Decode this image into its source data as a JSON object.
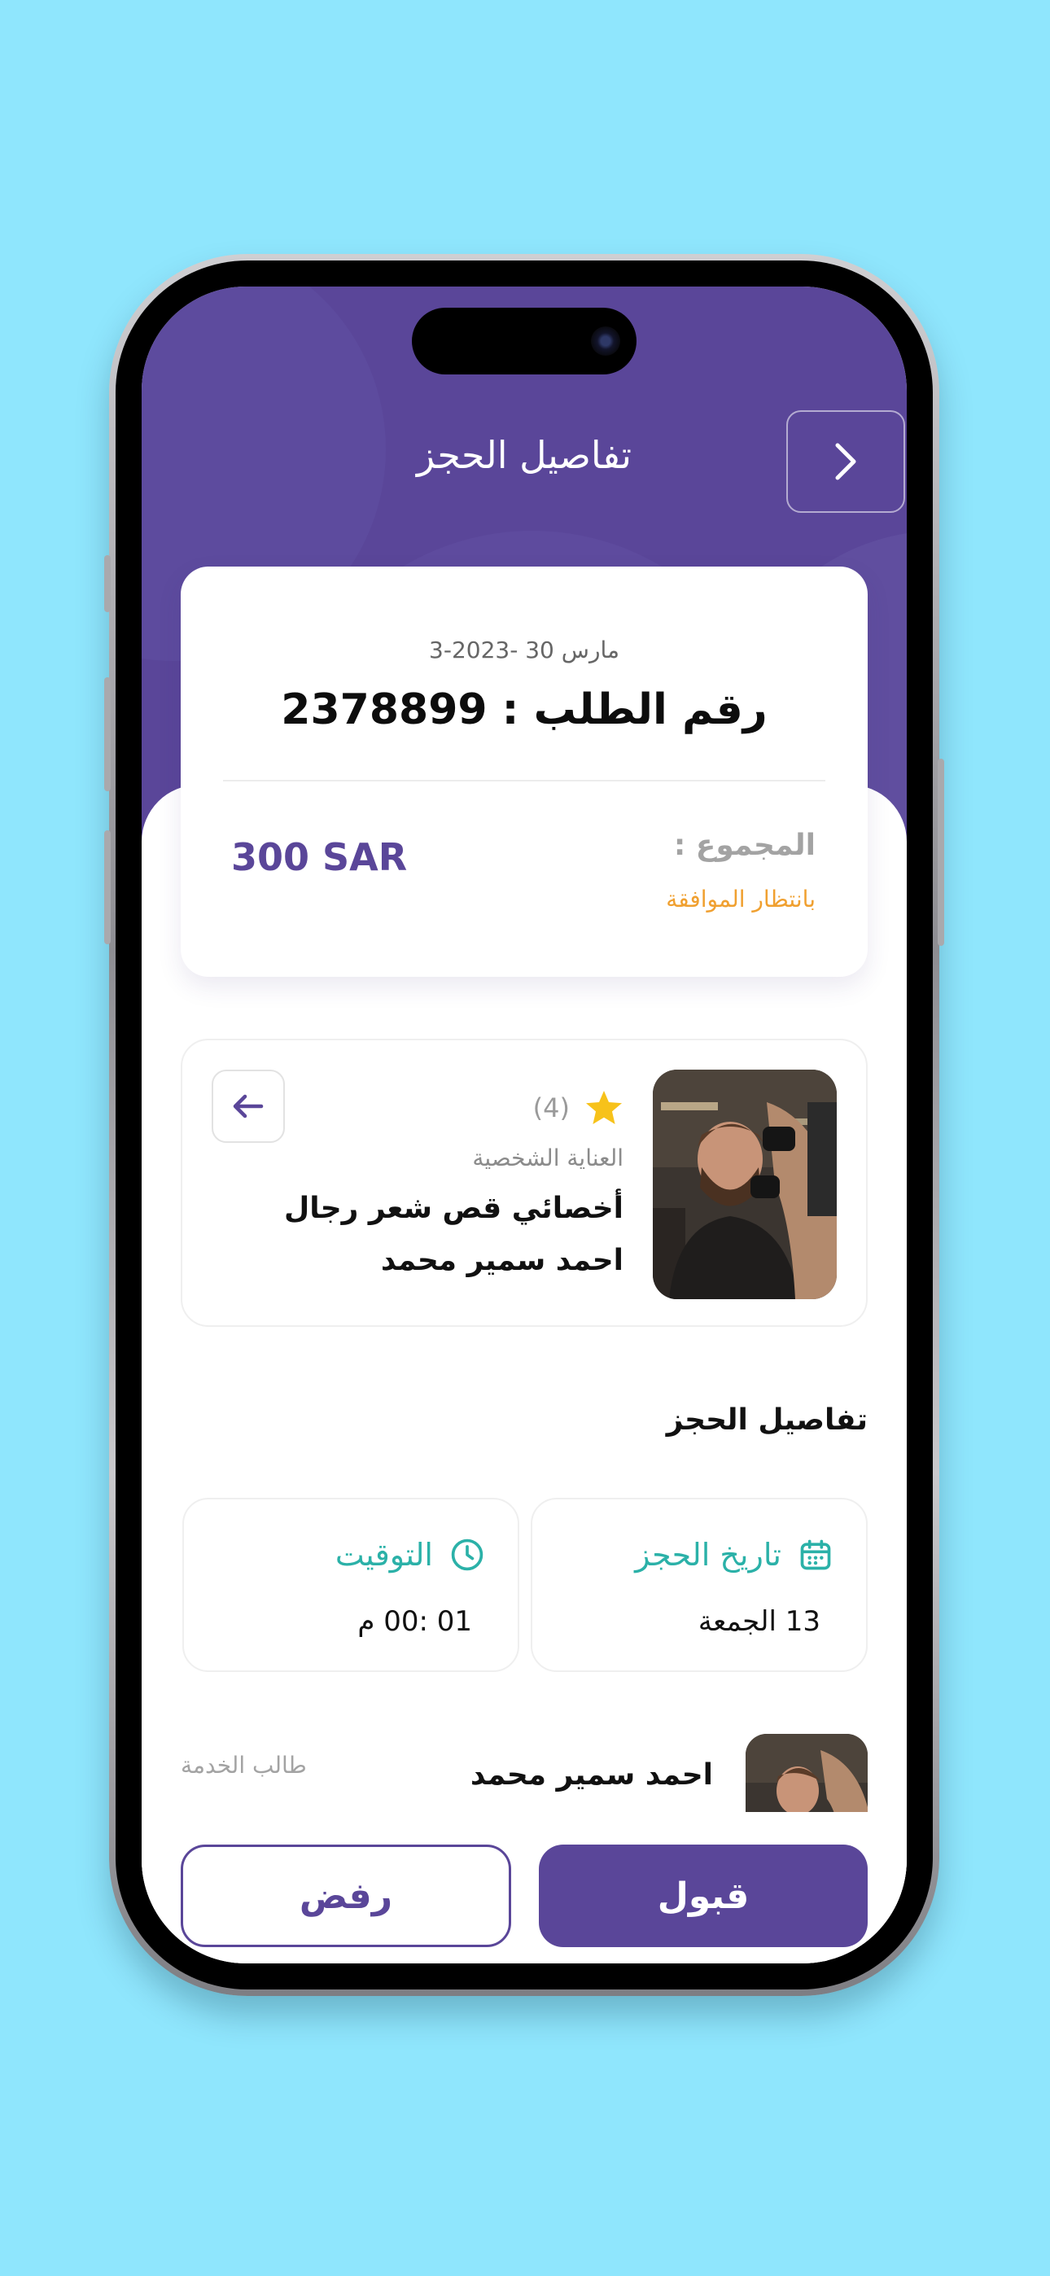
{
  "header": {
    "title": "تفاصيل الحجز"
  },
  "order": {
    "date": "مارس 30 -2023-3",
    "number_label": "رقم الطلب : 2378899",
    "total_label": "المجموع :",
    "status": "بانتظار الموافقة",
    "total_value": "300 SAR"
  },
  "service": {
    "rating_count": "(4)",
    "category": "العناية الشخصية",
    "title": "أخصائي قص شعر رجال",
    "provider": "احمد سمير محمد"
  },
  "details": {
    "section_title": "تفاصيل الحجز",
    "booking_date": {
      "label": "تاريخ الحجز",
      "value": "13 الجمعة"
    },
    "time": {
      "label": "التوقيت",
      "value": "01 :00 م"
    }
  },
  "requester": {
    "name": "احمد سمير محمد",
    "label": "طالب الخدمة"
  },
  "actions": {
    "accept_label": "قبول",
    "reject_label": "رفض"
  },
  "colors": {
    "brand": "#5a4699",
    "accent_teal": "#2bb1a8",
    "pending_orange": "#f0a030",
    "star": "#f7c21a"
  }
}
